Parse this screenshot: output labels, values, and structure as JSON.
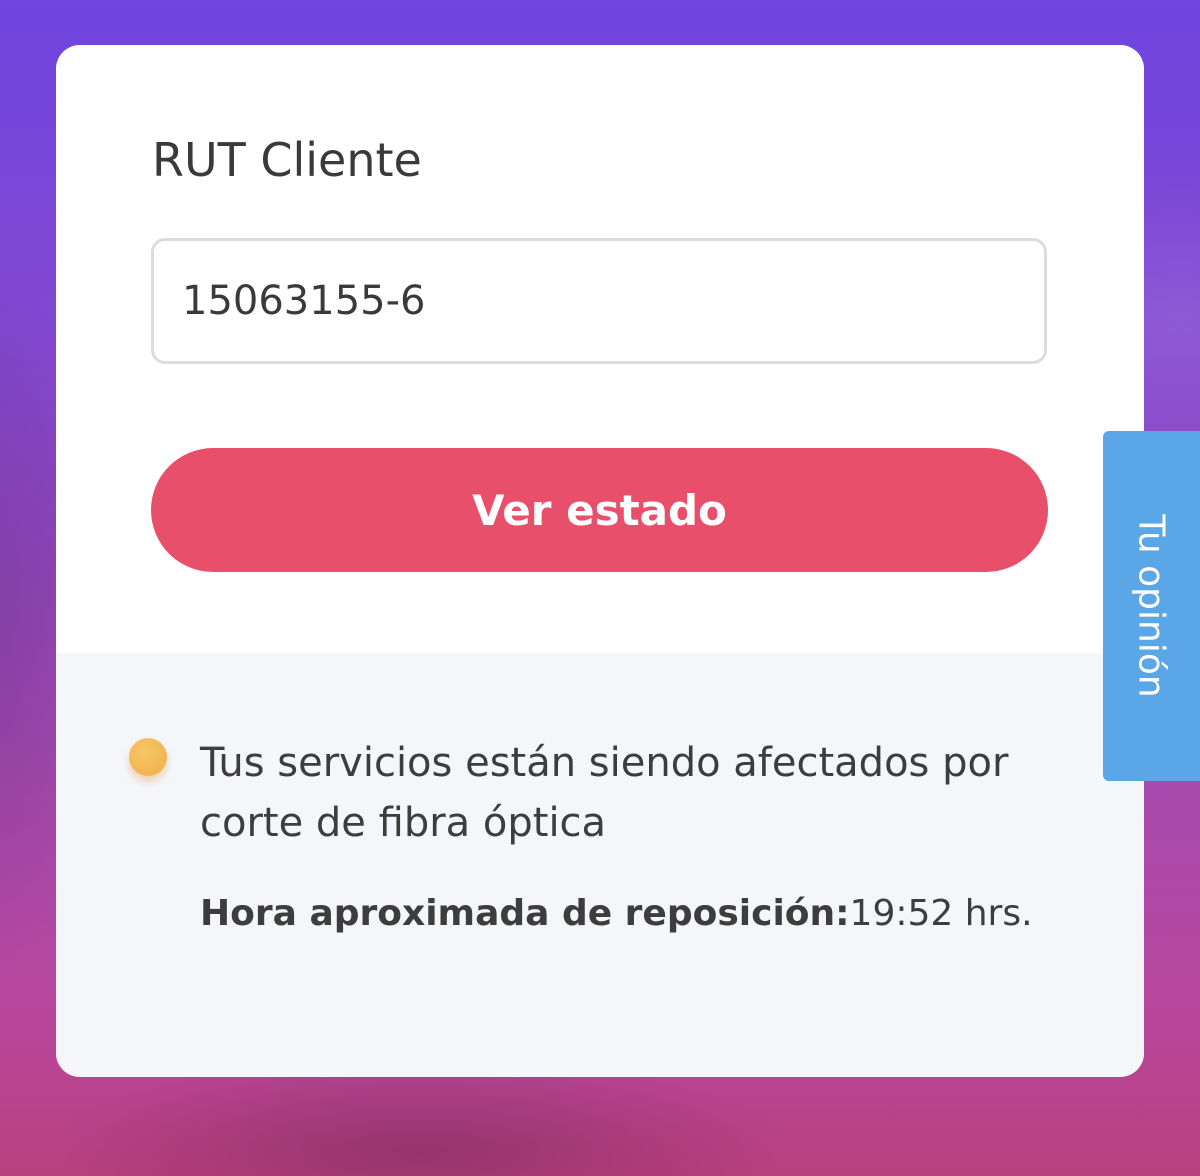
{
  "form": {
    "label": "RUT Cliente",
    "rut_value": "15063155-6",
    "submit_label": "Ver estado"
  },
  "status": {
    "indicator_color": "#efae44",
    "message": "Tus servicios están siendo afectados por corte de fibra óptica",
    "eta_label": "Hora aproximada de reposición:",
    "eta_value": "19:52 hrs."
  },
  "feedback_tab": {
    "label": "Tu opinión"
  },
  "colors": {
    "accent_button": "#e84f6a",
    "feedback_tab": "#5aa6e6",
    "background_top": "#6f45e0",
    "background_bottom": "#b9407f"
  }
}
